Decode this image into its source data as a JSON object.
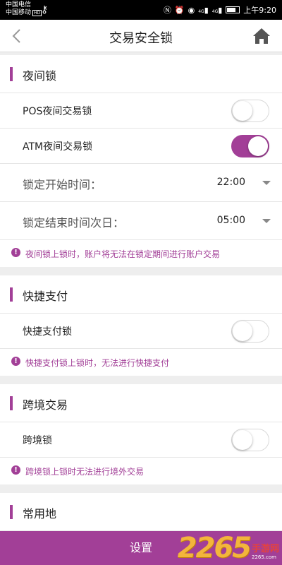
{
  "status_bar": {
    "carrier1": "中国电信",
    "carrier2": "中国移动",
    "hd_badge": "HD",
    "signal_label": "4G",
    "time": "上午9:20"
  },
  "header": {
    "title": "交易安全锁"
  },
  "sections": {
    "night_lock": {
      "title": "夜间锁",
      "pos_label": "POS夜间交易锁",
      "pos_on": false,
      "atm_label": "ATM夜间交易锁",
      "atm_on": true,
      "start_label": "锁定开始时间：",
      "start_value": "22:00",
      "end_label": "锁定结束时间次日：",
      "end_value": "05:00",
      "hint": "夜间锁上锁时，账户将无法在锁定期间进行账户交易"
    },
    "quick_pay": {
      "title": "快捷支付",
      "lock_label": "快捷支付锁",
      "lock_on": false,
      "hint": "快捷支付锁上锁时，无法进行快捷支付"
    },
    "cross_border": {
      "title": "跨境交易",
      "lock_label": "跨境锁",
      "lock_on": false,
      "hint": "跨境锁上锁时无法进行境外交易"
    },
    "common_place": {
      "title": "常用地"
    }
  },
  "bottom_button": {
    "label": "设置"
  },
  "watermark": {
    "number": "2265",
    "cn": "手游网",
    "url": "2265.com"
  },
  "colors": {
    "accent": "#a23f97",
    "background": "#eeeeee"
  }
}
